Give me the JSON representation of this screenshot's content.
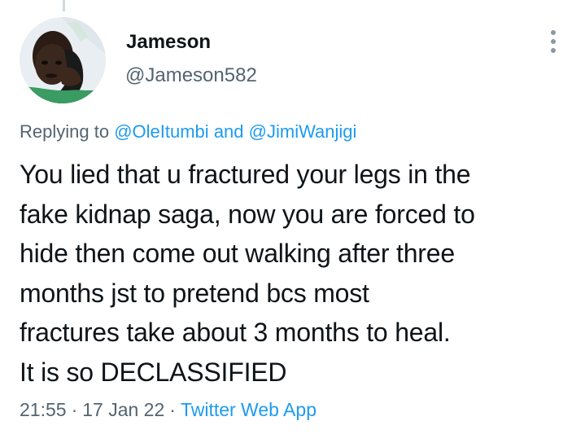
{
  "tweet": {
    "author": {
      "name": "Jameson",
      "handle": "@Jameson582"
    },
    "replying_to": {
      "prefix": "Replying to",
      "mention_1": "@OleItumbi",
      "connector": "and",
      "mention_2": "@JimiWanjigi"
    },
    "text_lines": [
      "You lied that u fractured your legs in the",
      "fake kidnap saga, now you are forced to",
      "hide then come out walking after three",
      "months jst to pretend bcs most",
      "fractures take about 3 months to heal.",
      "It is so DECLASSIFIED"
    ],
    "meta": {
      "time": "21:55",
      "separator": "·",
      "date": "17 Jan 22",
      "source": "Twitter Web App"
    }
  },
  "icons": {
    "more": "more-vertical-icon"
  },
  "colors": {
    "text_primary": "#0f1419",
    "text_secondary": "#536471",
    "link": "#1d9bf0",
    "icon": "#8899a6"
  }
}
